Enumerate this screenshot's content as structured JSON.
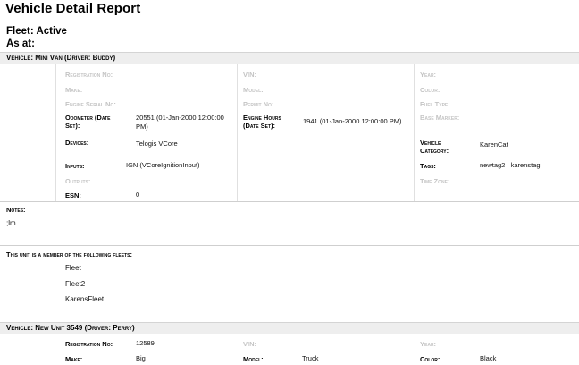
{
  "report": {
    "title": "Vehicle Detail Report",
    "fleet_line": "Fleet: Active",
    "as_at_line": "As at:"
  },
  "vehicle1": {
    "header": "Vehicle: Mini Van (Driver: Buddy)",
    "col1": {
      "registration_no": "Registration No:",
      "make": "Make:",
      "engine_serial_no": "Engine Serial No:",
      "odometer_label_1": "Odometer (Date",
      "odometer_label_2": "Set):",
      "odometer_value_1": "20551 (01-Jan-2000 12:00:00",
      "odometer_value_2": "PM)",
      "devices_label": "Devices:",
      "devices_value": "Telogis VCore",
      "inputs_label": "Inputs:",
      "inputs_value": "IGN (VCoreIgnitionInput)",
      "outputs_label": "Outputs:",
      "esn_label": "ESN:",
      "esn_value": "0"
    },
    "col2": {
      "vin": "VIN:",
      "model": "Model:",
      "permit_no": "Permit No:",
      "engine_hours_label_1": "Engine Hours",
      "engine_hours_label_2": "(Date Set):",
      "engine_hours_value": "1941 (01-Jan-2000 12:00:00 PM)"
    },
    "col3": {
      "year": "Year:",
      "color": "Color:",
      "fuel_type": "Fuel Type:",
      "base_marker": "Base Marker:",
      "vehicle_category_label_1": "Vehicle",
      "vehicle_category_label_2": "Category:",
      "vehicle_category_value": "KarenCat",
      "tags_label": "Tags:",
      "tags_value": "newtag2 , karenstag",
      "time_zone": "Time Zone:"
    },
    "notes_label": "Notes:",
    "notes_value": ";lm",
    "fleets_label": "This unit is a member of the following fleets:",
    "fleets": [
      "Fleet",
      "Fleet2",
      "KarensFleet"
    ]
  },
  "vehicle2": {
    "header": "Vehicle: New Unit 3549 (Driver: Perry)",
    "registration_label": "Registration No:",
    "registration_value": "12589",
    "vin": "VIN:",
    "year": "Year:",
    "make_label": "Make:",
    "make_value": "Big",
    "model_label": "Model:",
    "model_value": "Truck",
    "color_label": "Color:",
    "color_value": "Black"
  }
}
